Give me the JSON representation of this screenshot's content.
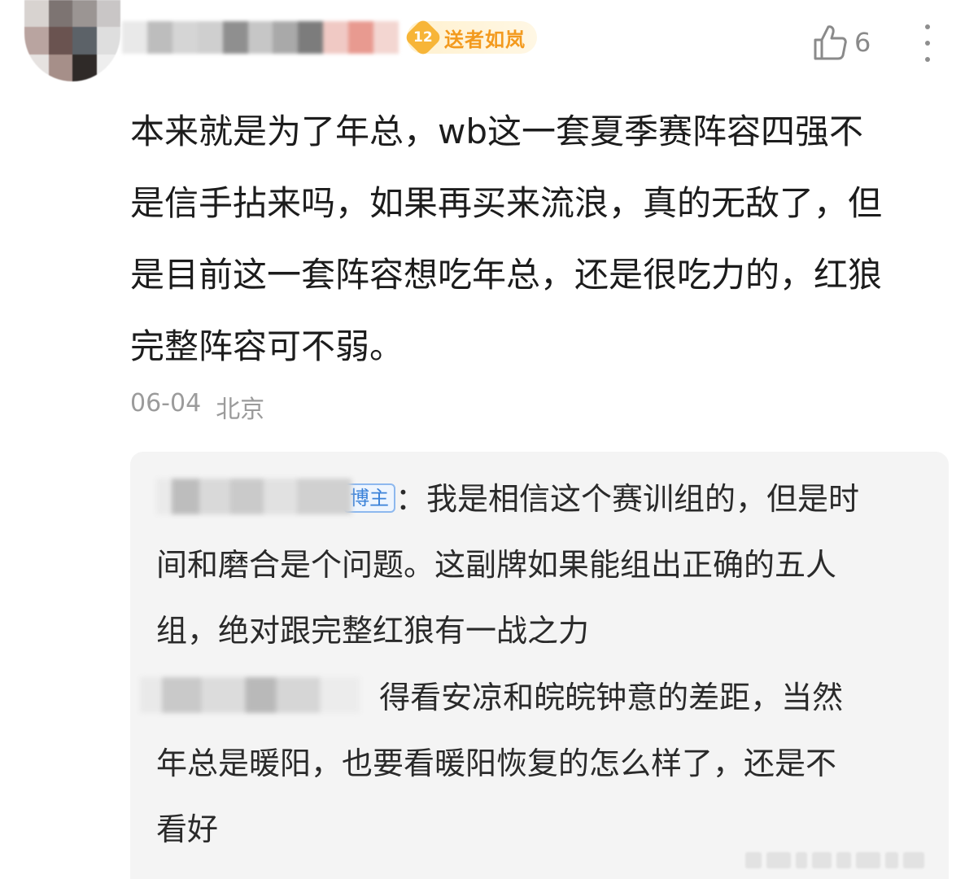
{
  "comment": {
    "fan_badge": {
      "level": "12",
      "name": "送者如岚",
      "color": "#f39a1e"
    },
    "like": {
      "icon": "thumbs-up-icon",
      "count": "6"
    },
    "more_icon": "more-vertical-icon",
    "text_lines": [
      "本来就是为了年总，wb这一套夏季赛阵容四强不",
      "是信手拈来吗，如果再买来流浪，真的无敌了，但",
      "是目前这一套阵容想吃年总，还是很吃力的，红狼",
      "完整阵容可不弱。"
    ],
    "date": "06-04",
    "location": "北京"
  },
  "replies": [
    {
      "author_tag": "博主",
      "lines": [
        "：我是相信这个赛训组的，但是时",
        "间和磨合是个问题。这副牌如果能组出正确的五人",
        "组，绝对跟完整红狼有一战之力"
      ]
    },
    {
      "lines": [
        "得看安凉和皖皖钟意的差距，当然",
        "年总是暖阳，也要看暖阳恢复的怎么样了，还是不",
        "看好"
      ]
    }
  ]
}
